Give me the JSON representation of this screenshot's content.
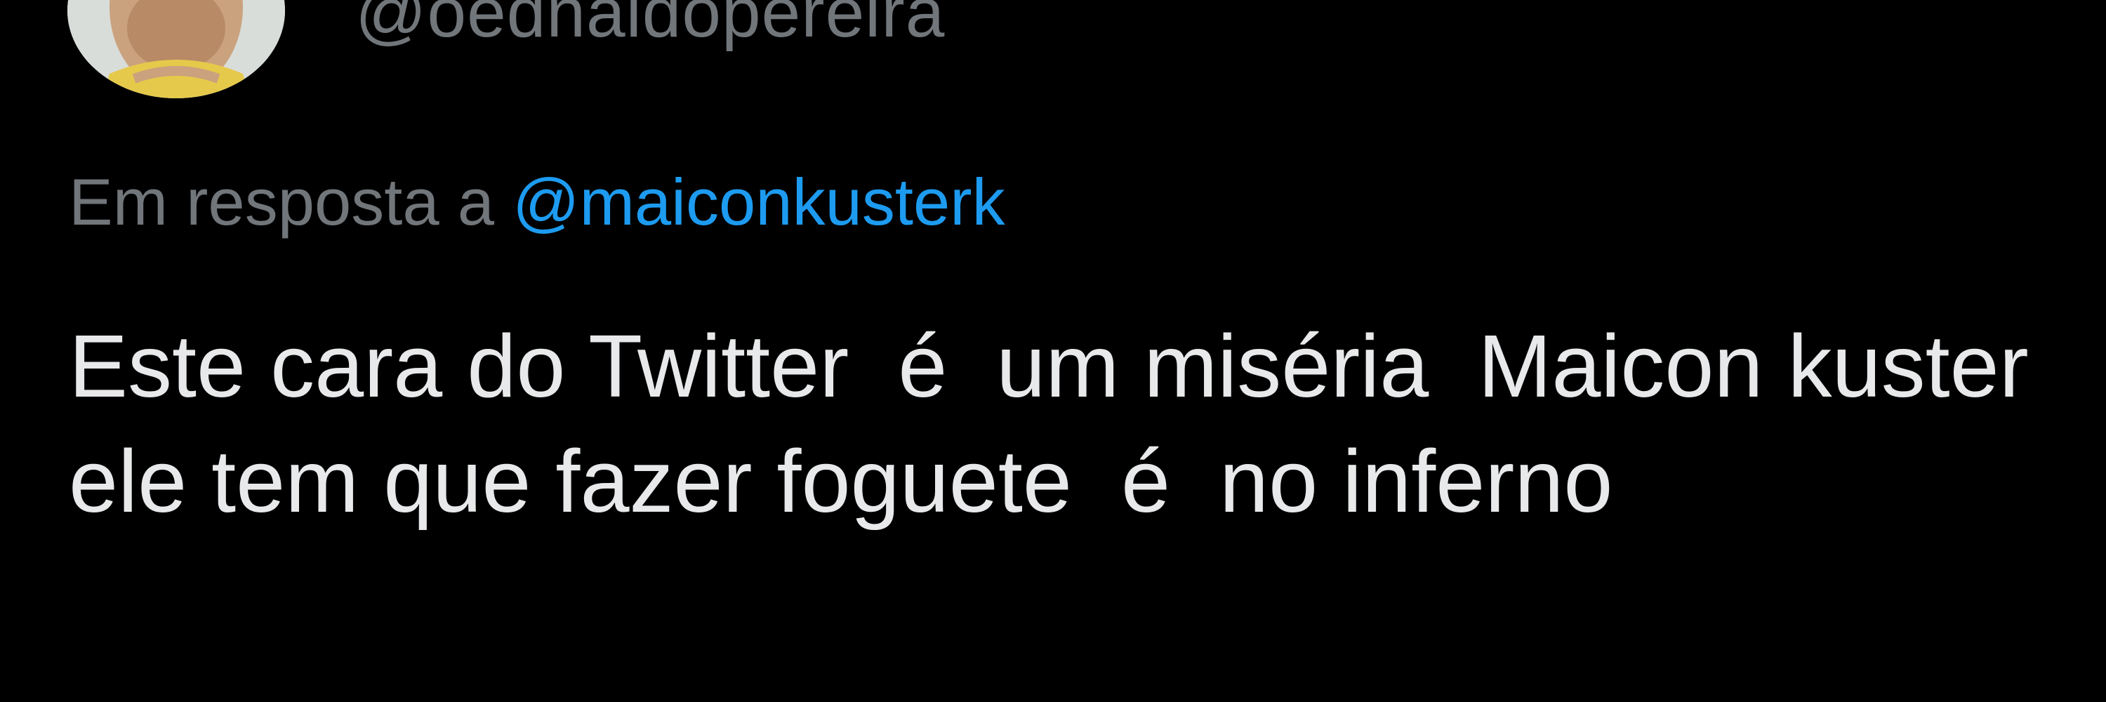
{
  "author": {
    "handle": "@oednaldopereira"
  },
  "reply": {
    "prefix": "Em resposta a ",
    "mention": "@maiconkusterk"
  },
  "tweet": {
    "text": "Este cara do Twitter  é  um miséria  Maicon kuster ele tem que fazer foguete  é  no inferno"
  },
  "colors": {
    "background": "#000000",
    "text_primary": "#e7e9ea",
    "text_secondary": "#71767b",
    "link": "#1d9bf0"
  }
}
